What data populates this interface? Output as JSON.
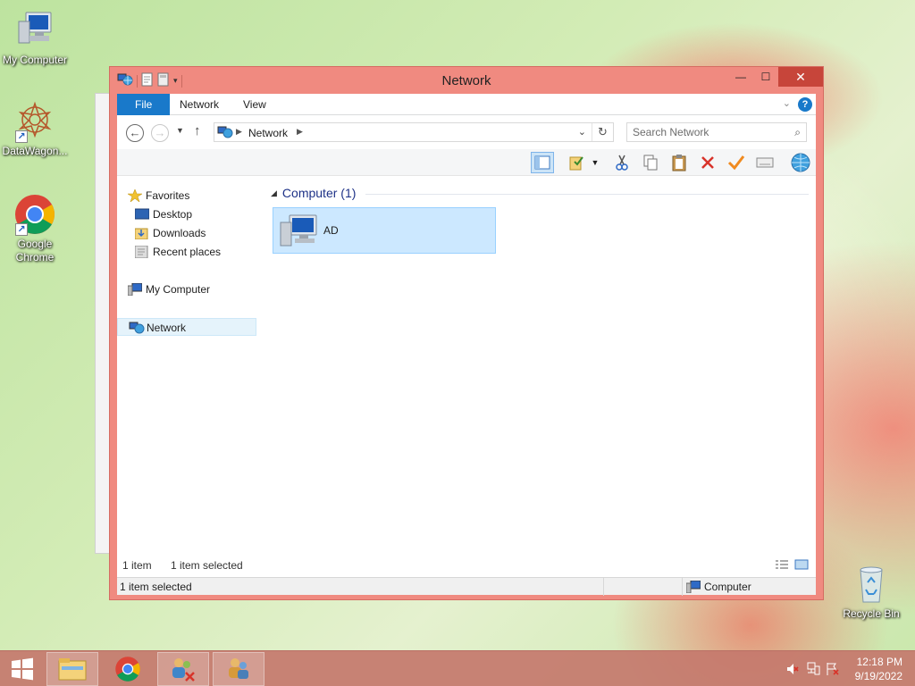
{
  "desktop": {
    "icons": [
      {
        "label": "My Computer"
      },
      {
        "label": "DataWagon..."
      },
      {
        "label": "Google Chrome"
      },
      {
        "label": "Recycle Bin"
      }
    ]
  },
  "window": {
    "title": "Network",
    "controls": {
      "minimize": "—",
      "maximize": "☐",
      "close": "✕"
    }
  },
  "ribbon": {
    "tabs": [
      "File",
      "Network",
      "View"
    ],
    "help": "?"
  },
  "address": {
    "crumb": "Network",
    "search_placeholder": "Search Network"
  },
  "nav": {
    "favorites": "Favorites",
    "desktop": "Desktop",
    "downloads": "Downloads",
    "recent": "Recent places",
    "my_computer": "My Computer",
    "network": "Network"
  },
  "content": {
    "group_header": "Computer (1)",
    "items": [
      {
        "label": "AD"
      }
    ]
  },
  "status": {
    "item_count": "1 item",
    "selected_count": "1 item selected",
    "bottom_left": "1 item selected",
    "bottom_zone": "Computer"
  },
  "taskbar": {
    "time": "12:18 PM",
    "date": "9/19/2022"
  },
  "colors": {
    "accent": "#1979ca",
    "window_frame": "#f08a80",
    "close_button": "#c7453a",
    "selection": "#cce8ff"
  }
}
